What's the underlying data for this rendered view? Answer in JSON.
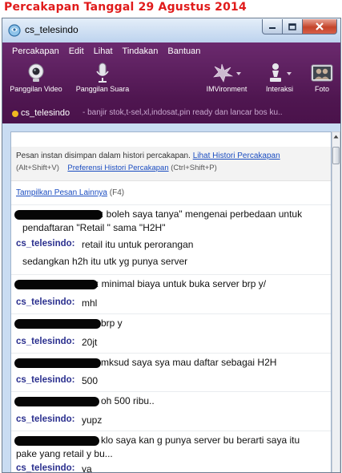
{
  "heading": "Percakapan Tanggal  29 Agustus 2014",
  "window": {
    "title": "cs_telesindo",
    "controls": [
      "minimize-icon",
      "maximize-icon",
      "close-icon"
    ]
  },
  "menu": [
    "Percakapan",
    "Edit",
    "Lihat",
    "Tindakan",
    "Bantuan"
  ],
  "tools": {
    "video": "Panggilan Video",
    "voice": "Panggilan Suara",
    "imvironment": "IMVironment",
    "interaksi": "Interaksi",
    "foto": "Foto"
  },
  "status": {
    "name": "cs_telesindo",
    "separator": " - ",
    "message": "banjir stok,t-sel,xl,indosat,pin ready dan lancar bos ku.."
  },
  "history": {
    "notice": "Pesan instan disimpan dalam histori percakapan.",
    "view_link": "Lihat Histori Percakapan",
    "view_shortcut": "(Alt+Shift+V)",
    "pref_link": "Preferensi Histori Percakapan",
    "pref_shortcut": "(Ctrl+Shift+P)"
  },
  "show_more": {
    "link": "Tampilkan Pesan Lainnya",
    "shortcut": "(F4)"
  },
  "messages": [
    {
      "sender": "",
      "text1": ": boleh saya tanya\" mengenai perbedaan untuk",
      "text2": "pendaftaran \"Retail \" sama  \"H2H\""
    },
    {
      "sender": "cs_telesindo:",
      "text1": "retail itu untuk perorangan",
      "text2": "sedangkan h2h itu utk yg punya server"
    },
    {
      "sender": "",
      "text1": ": minimal biaya untuk buka server brp y/"
    },
    {
      "sender": "cs_telesindo:",
      "text1": "mhl"
    },
    {
      "sender": "",
      "text1": "brp y"
    },
    {
      "sender": "cs_telesindo:",
      "text1": "20jt"
    },
    {
      "sender": "",
      "text1": "mksud saya sya mau daftar sebagai H2H"
    },
    {
      "sender": "cs_telesindo:",
      "text1": "500"
    },
    {
      "sender": "",
      "text1": "oh 500 ribu.."
    },
    {
      "sender": "cs_telesindo:",
      "text1": "yupz"
    },
    {
      "sender": "",
      "text1": "klo saya kan g punya server bu berarti saya itu",
      "text2": "pake yang retail y bu..."
    },
    {
      "sender": "cs_telesindo:",
      "text1": "ya"
    }
  ],
  "colors": {
    "heading": "#e01b1b",
    "toolbar": "#5a1d5c",
    "sender": "#2a2f8e",
    "link": "#1a4cc0"
  }
}
